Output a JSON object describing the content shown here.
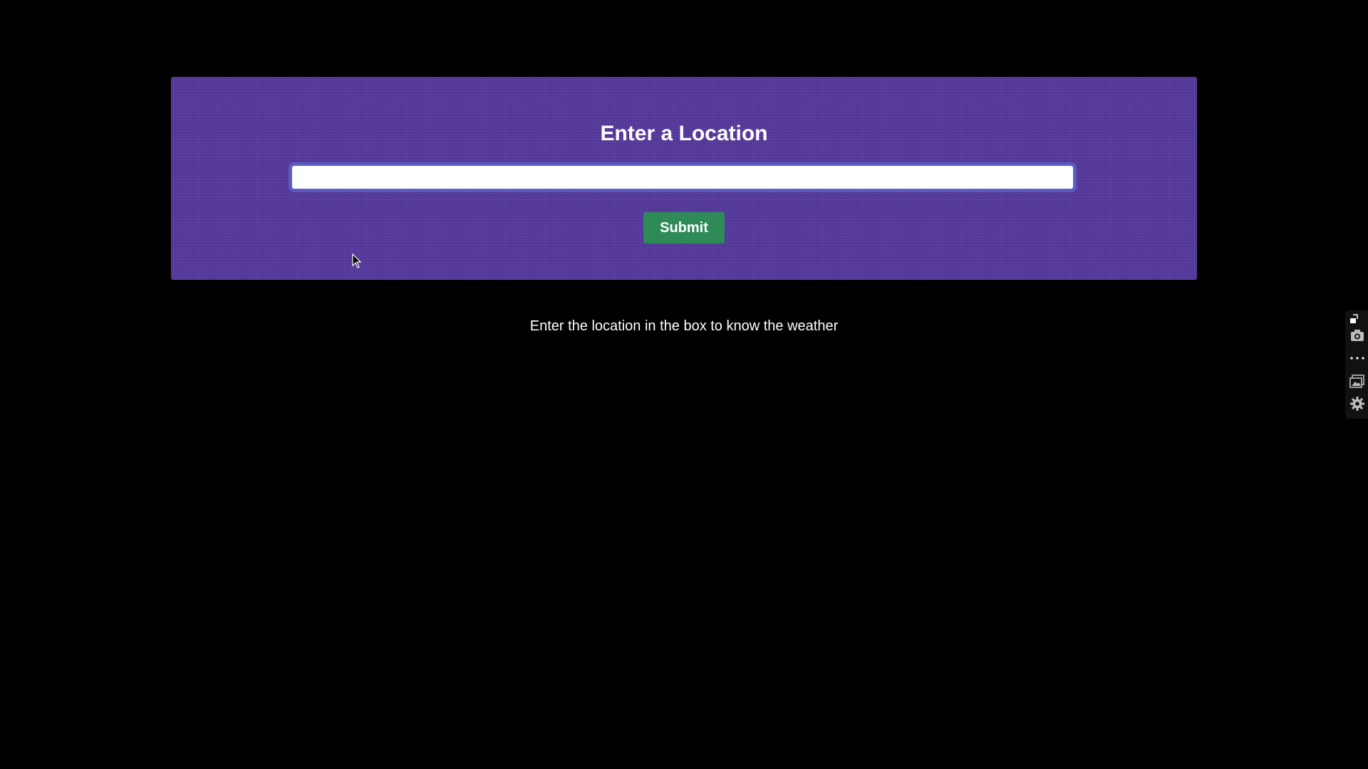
{
  "form": {
    "title": "Enter a Location",
    "input_value": "",
    "input_placeholder": "",
    "submit_label": "Submit"
  },
  "hint": {
    "text": "Enter the location in the box to know the weather"
  },
  "colors": {
    "panel_bg": "#563a9c",
    "submit_bg": "#2e8b57",
    "page_bg": "#000000"
  },
  "side_toolbar": {
    "icons": [
      "pin-icon",
      "camera-icon",
      "more-icon",
      "gallery-icon",
      "gear-icon"
    ]
  }
}
